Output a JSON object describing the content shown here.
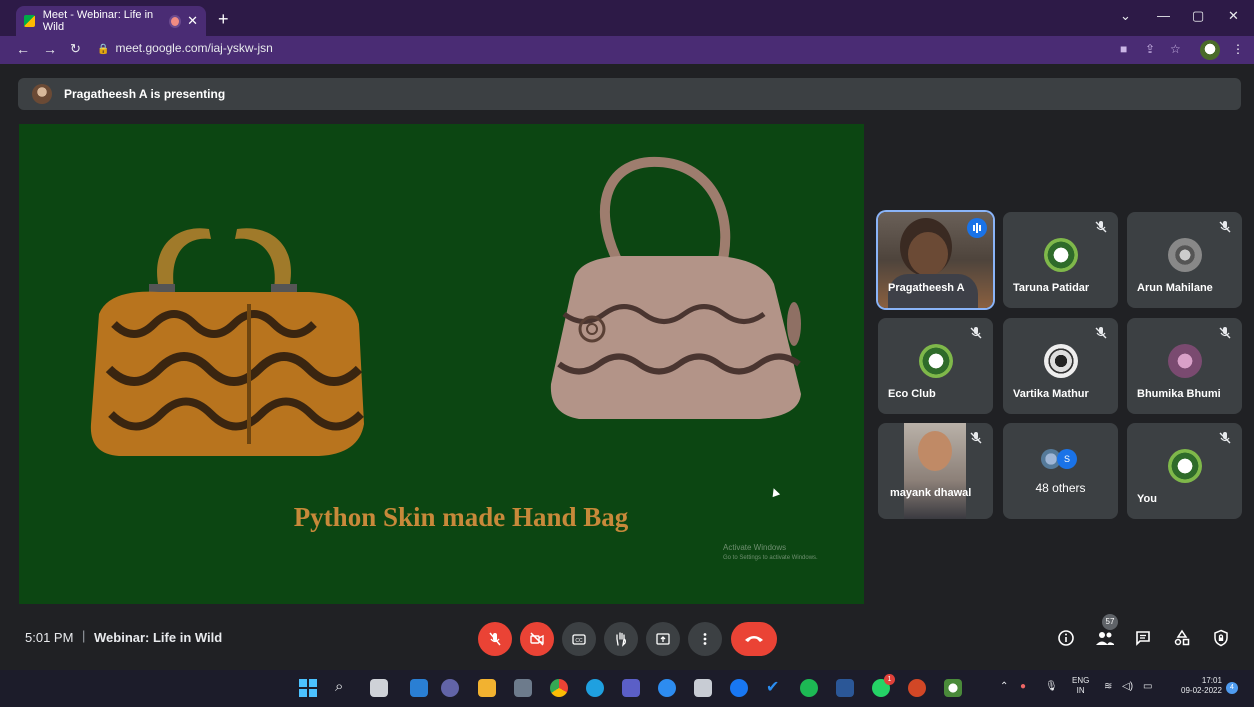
{
  "browser": {
    "tab_title": "Meet - Webinar: Life in Wild",
    "new_tab_icon": "plus-icon",
    "url": "meet.google.com/iaj-yskw-jsn"
  },
  "banner": {
    "text": "Pragatheesh A is presenting"
  },
  "slide": {
    "title": "Python Skin made Hand Bag",
    "watermark_line1": "Activate Windows",
    "watermark_line2": "Go to Settings to activate Windows."
  },
  "participants": [
    {
      "name": "Pragatheesh A",
      "state": "speaking"
    },
    {
      "name": "Taruna Patidar",
      "state": "muted"
    },
    {
      "name": "Arun Mahilane",
      "state": "muted"
    },
    {
      "name": "Eco Club",
      "state": "muted"
    },
    {
      "name": "Vartika Mathur",
      "state": "muted"
    },
    {
      "name": "Bhumika Bhumi",
      "state": "muted"
    },
    {
      "name": "mayank dhawal",
      "state": "muted"
    },
    {
      "name": "48 others",
      "avatar_letter": "S"
    },
    {
      "name": "You",
      "state": "muted"
    }
  ],
  "bottom": {
    "time": "5:01 PM",
    "separator": "|",
    "meeting_name": "Webinar: Life in Wild",
    "people_count": "57"
  },
  "taskbar": {
    "lang_line1": "ENG",
    "lang_line2": "IN",
    "clock_time": "17:01",
    "clock_date": "09-02-2022",
    "notification_count": "4",
    "whatsapp_badge": "1"
  },
  "colors": {
    "slide_bg": "#0c4612",
    "slide_title": "#c8893a",
    "end_call": "#ea4335",
    "tile_bg": "#3c4043",
    "browser_frame": "#4a2c74"
  }
}
